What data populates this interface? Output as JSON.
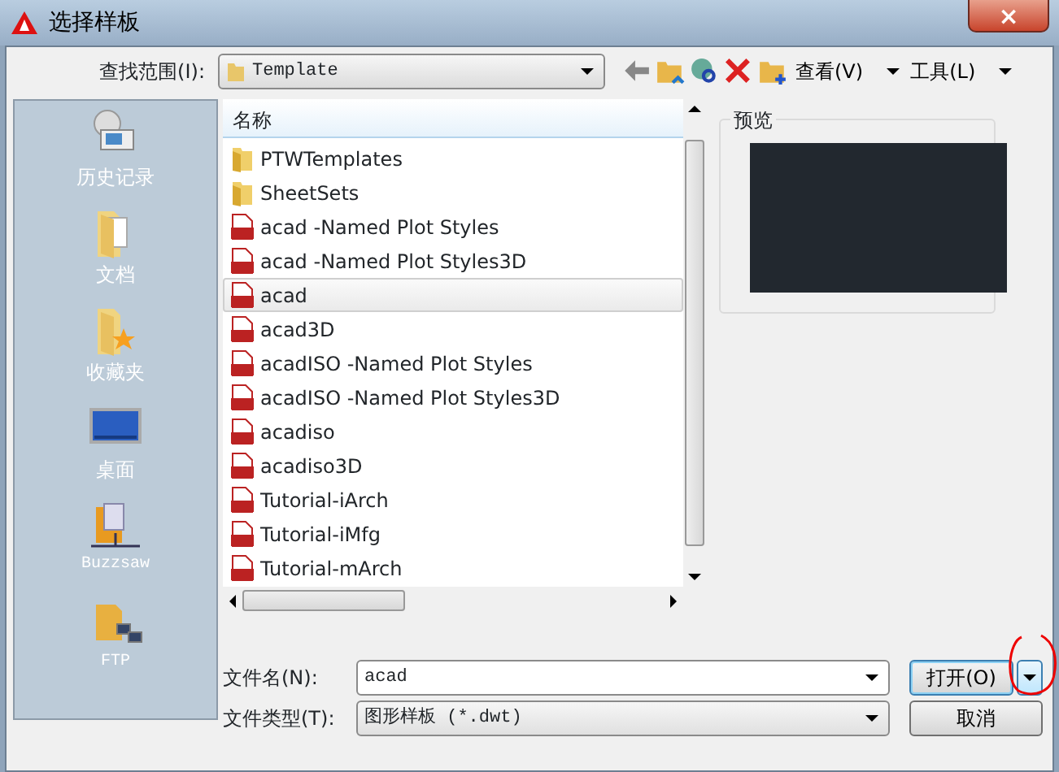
{
  "window": {
    "title": "选择样板",
    "close": "×"
  },
  "look_in": {
    "label": "查找范围(I):",
    "value": "Template"
  },
  "toolbar": [
    {
      "kind": "back"
    },
    {
      "kind": "up"
    },
    {
      "kind": "search"
    },
    {
      "kind": "delete"
    },
    {
      "kind": "newfolder"
    },
    {
      "kind": "menu",
      "label": "查看(V)"
    },
    {
      "kind": "menu",
      "label": "工具(L)"
    }
  ],
  "places": [
    {
      "kind": "history",
      "label": "历史记录"
    },
    {
      "kind": "documents",
      "label": "文档"
    },
    {
      "kind": "favorites",
      "label": "收藏夹"
    },
    {
      "kind": "desktop",
      "label": "桌面"
    },
    {
      "kind": "buzzsaw",
      "label": "Buzzsaw"
    },
    {
      "kind": "ftp",
      "label": "FTP"
    }
  ],
  "file_list": {
    "column": "名称",
    "items": [
      {
        "kind": "folder",
        "name": "PTWTemplates",
        "selected": false
      },
      {
        "kind": "folder",
        "name": "SheetSets",
        "selected": false
      },
      {
        "kind": "dwt",
        "name": "acad -Named Plot Styles",
        "selected": false
      },
      {
        "kind": "dwt",
        "name": "acad -Named Plot Styles3D",
        "selected": false
      },
      {
        "kind": "dwt",
        "name": "acad",
        "selected": true
      },
      {
        "kind": "dwt",
        "name": "acad3D",
        "selected": false
      },
      {
        "kind": "dwt",
        "name": "acadISO -Named Plot Styles",
        "selected": false
      },
      {
        "kind": "dwt",
        "name": "acadISO -Named Plot Styles3D",
        "selected": false
      },
      {
        "kind": "dwt",
        "name": "acadiso",
        "selected": false
      },
      {
        "kind": "dwt",
        "name": "acadiso3D",
        "selected": false
      },
      {
        "kind": "dwt",
        "name": "Tutorial-iArch",
        "selected": false
      },
      {
        "kind": "dwt",
        "name": "Tutorial-iMfg",
        "selected": false
      },
      {
        "kind": "dwt",
        "name": "Tutorial-mArch",
        "selected": false
      }
    ]
  },
  "preview": {
    "label": "预览"
  },
  "file_name": {
    "label": "文件名(N):",
    "value": "acad"
  },
  "file_type": {
    "label": "文件类型(T):",
    "value": "图形样板 (*.dwt)"
  },
  "buttons": {
    "open": "打开(O)",
    "cancel": "取消"
  }
}
